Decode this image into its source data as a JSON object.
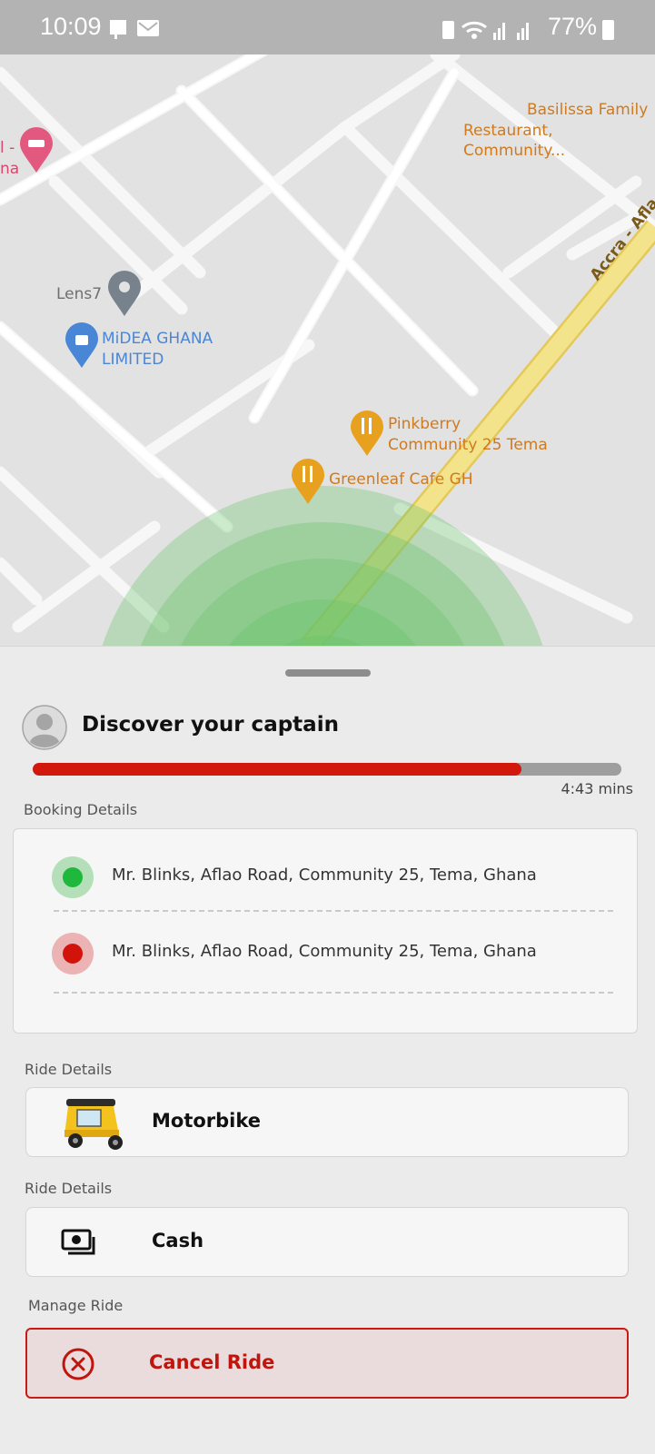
{
  "status_bar": {
    "time": "10:09",
    "battery": "77%"
  },
  "map": {
    "labels": {
      "basilissa_line1": "Basilissa Family",
      "basilissa_line2": "Restaurant, Community...",
      "hotel_partial_1": "l -",
      "hotel_partial_2": "na",
      "lens7": "Lens7",
      "midea_line1": "MiDEA GHANA",
      "midea_line2": "LIMITED",
      "pinkberry_line1": "Pinkberry",
      "pinkberry_line2": "Community 25 Tema",
      "greenleaf": "Greenleaf Cafe GH",
      "road": "Accra - Afla"
    },
    "colors": {
      "food_pin": "#e8a11f",
      "place_pin": "#78828c",
      "shop_pin": "#4a86d6",
      "hotel_pin": "#e3587e",
      "search_radius": "#6cc36c",
      "highway": "#f3e38a"
    }
  },
  "sheet": {
    "title": "Discover your captain",
    "progress_fraction": 0.83,
    "eta": "4:43 mins",
    "booking_label": "Booking Details",
    "pickup": {
      "address": "Mr. Blinks, Aflao Road, Community 25, Tema, Ghana",
      "color": "#1fb83c",
      "ring": "#b4dfb8"
    },
    "dropoff": {
      "address": "Mr. Blinks, Aflao Road, Community 25, Tema, Ghana",
      "color": "#d2130c",
      "ring": "#ebb3b3"
    },
    "ride_label": "Ride Details",
    "vehicle": "Motorbike",
    "payment_label": "Ride Details",
    "payment": "Cash",
    "manage_label": "Manage Ride",
    "cancel_label": "Cancel Ride"
  }
}
